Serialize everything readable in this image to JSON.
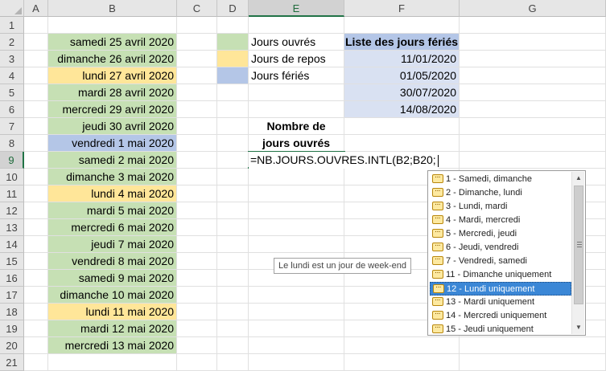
{
  "columns": [
    "A",
    "B",
    "C",
    "D",
    "E",
    "F",
    "G"
  ],
  "rows": [
    "1",
    "2",
    "3",
    "4",
    "5",
    "6",
    "7",
    "8",
    "9",
    "10",
    "11",
    "12",
    "13",
    "14",
    "15",
    "16",
    "17",
    "18",
    "19",
    "20",
    "21"
  ],
  "colors": {
    "workday": "#c6e0b4",
    "restday": "#ffe699",
    "holiday": "#b4c6e7",
    "holiday_list_bg": "#d9e1f2",
    "selection": "#217346",
    "dropdown_selected": "#3b87d6"
  },
  "dates": [
    {
      "text": "samedi 25 avril 2020",
      "kind": "workday"
    },
    {
      "text": "dimanche 26 avril 2020",
      "kind": "workday"
    },
    {
      "text": "lundi 27 avril 2020",
      "kind": "restday"
    },
    {
      "text": "mardi 28 avril 2020",
      "kind": "workday"
    },
    {
      "text": "mercredi 29 avril 2020",
      "kind": "workday"
    },
    {
      "text": "jeudi 30 avril 2020",
      "kind": "workday"
    },
    {
      "text": "vendredi 1 mai 2020",
      "kind": "holiday"
    },
    {
      "text": "samedi 2 mai 2020",
      "kind": "workday"
    },
    {
      "text": "dimanche 3 mai 2020",
      "kind": "workday"
    },
    {
      "text": "lundi 4 mai 2020",
      "kind": "restday"
    },
    {
      "text": "mardi 5 mai 2020",
      "kind": "workday"
    },
    {
      "text": "mercredi 6 mai 2020",
      "kind": "workday"
    },
    {
      "text": "jeudi 7 mai 2020",
      "kind": "workday"
    },
    {
      "text": "vendredi 8 mai 2020",
      "kind": "workday"
    },
    {
      "text": "samedi 9 mai 2020",
      "kind": "workday"
    },
    {
      "text": "dimanche 10 mai 2020",
      "kind": "workday"
    },
    {
      "text": "lundi 11 mai 2020",
      "kind": "restday"
    },
    {
      "text": "mardi 12 mai 2020",
      "kind": "workday"
    },
    {
      "text": "mercredi 13 mai 2020",
      "kind": "workday"
    }
  ],
  "legend": [
    {
      "label": "Jours ouvrés",
      "kind": "workday"
    },
    {
      "label": "Jours de repos",
      "kind": "restday"
    },
    {
      "label": "Jours fériés",
      "kind": "holiday"
    }
  ],
  "holidays": {
    "header": "Liste des jours fériés",
    "dates": [
      "11/01/2020",
      "01/05/2020",
      "30/07/2020",
      "14/08/2020"
    ]
  },
  "result_label_line1": "Nombre de",
  "result_label_line2": "jours ouvrés",
  "formula": "=NB.JOURS.OUVRES.INTL(B2;B20;",
  "tooltip": "Le lundi est un jour de week-end",
  "dropdown": {
    "items": [
      "1 - Samedi, dimanche",
      "2 - Dimanche, lundi",
      "3 - Lundi, mardi",
      "4 - Mardi, mercredi",
      "5 - Mercredi, jeudi",
      "6 - Jeudi, vendredi",
      "7 - Vendredi, samedi",
      "11 - Dimanche uniquement",
      "12 - Lundi uniquement",
      "13 - Mardi uniquement",
      "14 - Mercredi uniquement",
      "15 - Jeudi uniquement"
    ],
    "selected_index": 8,
    "icon": "constant-value-icon"
  },
  "active_cell": {
    "column": "E",
    "row": "9"
  }
}
